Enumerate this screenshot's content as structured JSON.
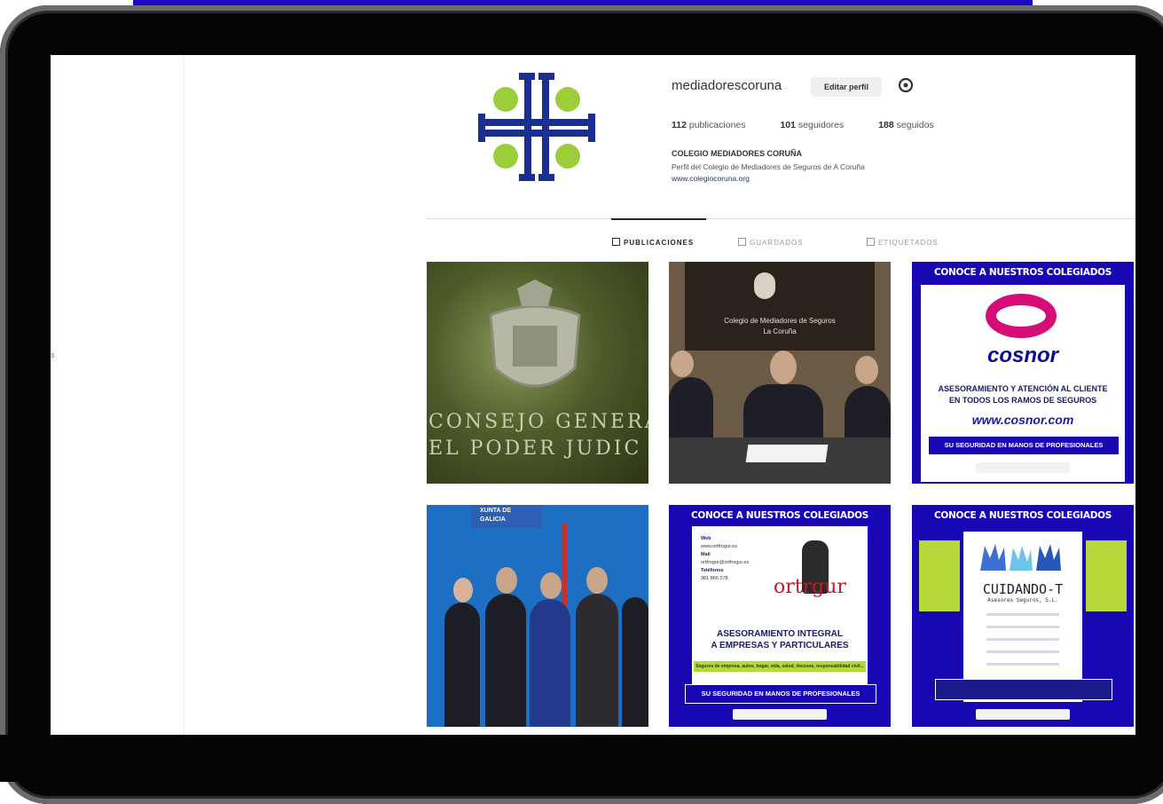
{
  "sidebar": {
    "cut_text": "s"
  },
  "profile": {
    "username": "mediadorescoruna",
    "edit_button": "Editar perfil",
    "stats": {
      "posts_count": "112",
      "posts_label": "publicaciones",
      "followers_count": "101",
      "followers_label": "seguidores",
      "following_count": "188",
      "following_label": "seguidos"
    },
    "bio_name": "COLEGIO MEDIADORES CORUÑA",
    "bio_description": "Perfil del Colegio de Mediadores de Seguros de A Coruña",
    "bio_link": "www.colegiocoruna.org"
  },
  "tabs": [
    {
      "label": "PUBLICACIONES",
      "active": true
    },
    {
      "label": "GUARDADOS",
      "active": false
    },
    {
      "label": "ETIQUETADOS",
      "active": false
    }
  ],
  "posts": {
    "p1": {
      "line1": "CONSEJO GENERA",
      "line2": "EL PODER JUDIC"
    },
    "p2": {
      "banner_title": "Colegio de Mediadores de Seguros",
      "banner_sub": "La Coruña"
    },
    "p3": {
      "header": "CONOCE A NUESTROS COLEGIADOS",
      "brand": "cosnor",
      "line1": "ASESORAMIENTO Y ATENCIÓN AL CLIENTE",
      "line2": "EN TODOS LOS RAMOS DE SEGUROS",
      "web": "www.cosnor.com",
      "slogan": "SU SEGURIDAD EN MANOS DE PROFESIONALES"
    },
    "p4": {
      "sign": "XUNTA DE GALICIA"
    },
    "p5": {
      "header": "CONOCE A NUESTROS COLEGIADOS",
      "info_web_label": "Web",
      "info_web": "www.ortfrogur.es",
      "info_mail_label": "Mail",
      "info_mail": "ortfrogur@ortfrogur.es",
      "info_phone_label": "Teléfonos",
      "info_phone": "981 866 278",
      "brand": "ortrgur",
      "h1": "ASESORAMIENTO INTEGRAL",
      "h2": "A EMPRESAS Y PARTICULARES",
      "green_text": "Seguros de empresa, autos, hogar, vida, salud, decesos, responsabilidad civil...",
      "slogan": "SU SEGURIDAD EN MANOS DE PROFESIONALES"
    },
    "p6": {
      "header": "CONOCE A NUESTROS COLEGIADOS",
      "brand": "CUIDANDO-T",
      "sub": "Asesores Seguros, S.L."
    }
  },
  "colors": {
    "brand_blue": "#1708b4",
    "logo_navy": "#1c2f8c",
    "logo_green": "#9ccd3b",
    "cosnor_pink": "#d60d76",
    "lime": "#b7d83a"
  },
  "icons": {
    "settings": "gear-icon",
    "tab_posts": "grid-icon",
    "tab_saved": "bookmark-icon",
    "tab_tagged": "tag-icon"
  }
}
